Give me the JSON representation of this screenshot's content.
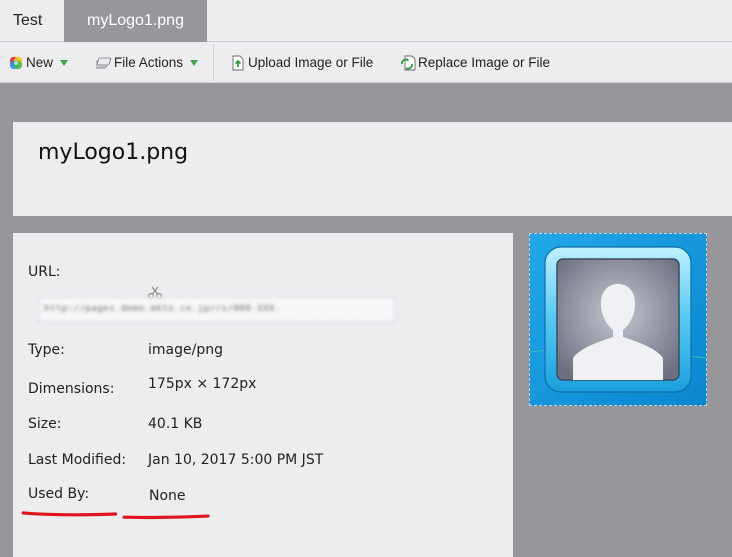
{
  "tabs": [
    {
      "label": "Test",
      "active": false
    },
    {
      "label": "myLogo1.png",
      "active": true
    }
  ],
  "toolbar": {
    "new_label": "New",
    "file_actions_label": "File Actions",
    "upload_label": "Upload Image or File",
    "replace_label": "Replace Image or File"
  },
  "file": {
    "title": "myLogo1.png",
    "url_label": "URL:",
    "url_value": "http://pages.demo.mkto.co.jp/rs/000-XXX-000/images/myLogo1.png",
    "type_label": "Type:",
    "type_value": "image/png",
    "dimensions_label": "Dimensions:",
    "dimensions_value": "175px × 172px",
    "size_label": "Size:",
    "size_value": "40.1 KB",
    "modified_label": "Last Modified:",
    "modified_value": "Jan 10, 2017 5:00 PM JST",
    "used_by_label": "Used By:",
    "used_by_value": "None"
  },
  "colors": {
    "accent_red": "#e0141e",
    "preview_blue": "#1098dc",
    "caret_green": "#3aa64a"
  },
  "icons": {
    "new": "color-wheel-icon",
    "file_actions": "file-stack-icon",
    "upload": "upload-document-icon",
    "replace": "replace-document-icon",
    "url_copy": "clip-icon"
  }
}
